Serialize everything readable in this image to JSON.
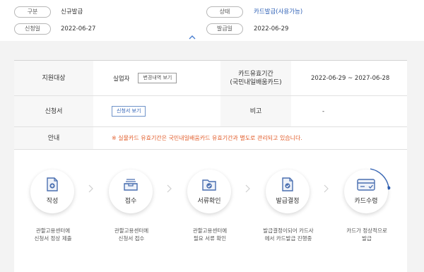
{
  "summary": {
    "type_label": "구분",
    "type_value": "신규발급",
    "status_label": "상태",
    "status_value": "카드발급(사용가능)",
    "apply_date_label": "신청일",
    "apply_date_value": "2022-06-27",
    "issue_date_label": "발급일",
    "issue_date_value": "2022-06-29",
    "collapse_icon": "chevron-up-icon"
  },
  "table": {
    "row1": {
      "label": "지원대상",
      "value": "실업자",
      "history_button": "변경내역 보기",
      "validity_label_line1": "카드유효기간",
      "validity_label_line2": "(국민내일배움카드)",
      "validity_value": "2022-06-29 ~ 2027-06-28"
    },
    "row2": {
      "label": "신청서",
      "view_button": "신청서 보기",
      "note_label": "비고",
      "note_value": "-"
    },
    "row3": {
      "label": "안내",
      "notice": "※ 실물카드 유효기간은 국민내일배움카드 유효기간과 별도로 관리되고 있습니다."
    }
  },
  "steps": [
    {
      "name": "작성",
      "icon": "document-plus-icon",
      "desc_line1": "관할고용센터에",
      "desc_line2": "신청서 정상 제출"
    },
    {
      "name": "접수",
      "icon": "inbox-tray-icon",
      "desc_line1": "관할고용센터에",
      "desc_line2": "신청서 접수"
    },
    {
      "name": "서류확인",
      "icon": "folder-check-icon",
      "desc_line1": "관할고용센터에",
      "desc_line2": "필요 서류 확인"
    },
    {
      "name": "발급결정",
      "icon": "document-check-icon",
      "desc_line1": "발급결정이되어 카드사",
      "desc_line2": "에서 카드발급 진행중"
    },
    {
      "name": "카드수령",
      "icon": "credit-card-icon",
      "desc_line1": "카드가 정상적으로",
      "desc_line2": "발급"
    }
  ],
  "colors": {
    "accent": "#2f61b6",
    "notice": "#e25c2a",
    "icon": "#4a6fb0"
  }
}
